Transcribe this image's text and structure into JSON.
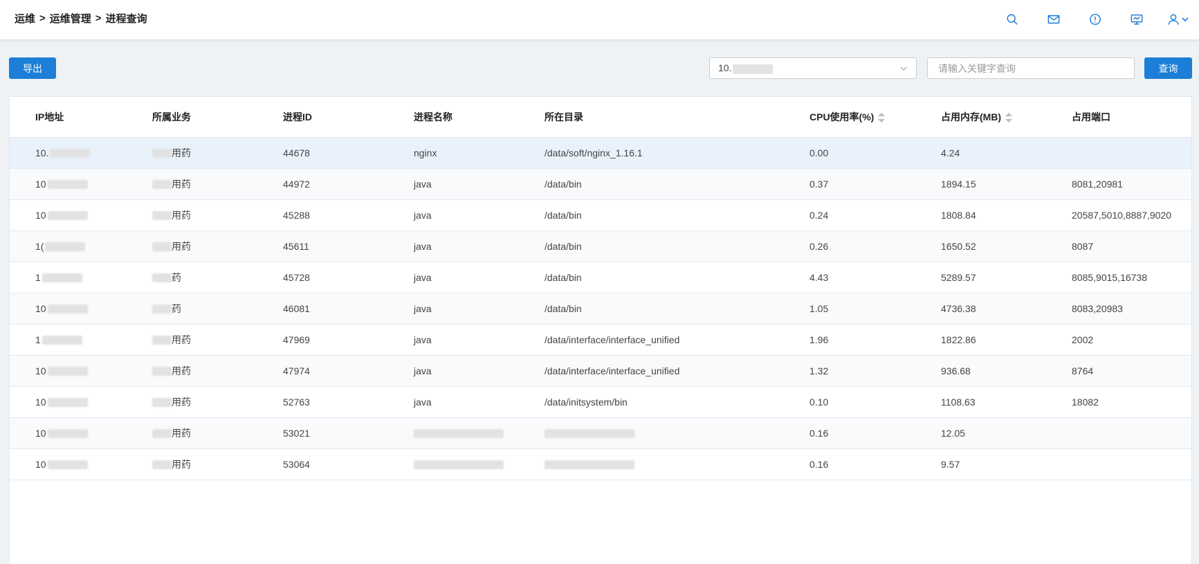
{
  "breadcrumb": {
    "items": [
      "运维",
      "运维管理",
      "进程查询"
    ],
    "separator": ">"
  },
  "header": {
    "icons": [
      "search-icon",
      "mail-icon",
      "alert-icon",
      "monitor-icon",
      "user-icon",
      "chevron-down-icon"
    ]
  },
  "toolbar": {
    "export_label": "导出",
    "ip_select_value": "10.",
    "keyword_placeholder": "请输入关键字查询",
    "search_label": "查询"
  },
  "table": {
    "columns": [
      "IP地址",
      "所属业务",
      "进程ID",
      "进程名称",
      "所在目录",
      "CPU使用率(%)",
      "占用内存(MB)",
      "占用端口"
    ],
    "rows": [
      {
        "ip": "10.",
        "business": "用药",
        "pid": "44678",
        "name": "nginx",
        "dir": "/data/soft/nginx_1.16.1",
        "cpu": "0.00",
        "mem": "4.24",
        "ports": ""
      },
      {
        "ip": "10",
        "business": "用药",
        "pid": "44972",
        "name": "java",
        "dir": "/data/bin",
        "cpu": "0.37",
        "mem": "1894.15",
        "ports": "8081,20981"
      },
      {
        "ip": "10",
        "business": "用药",
        "pid": "45288",
        "name": "java",
        "dir": "/data/bin",
        "cpu": "0.24",
        "mem": "1808.84",
        "ports": "20587,5010,8887,9020"
      },
      {
        "ip": "1(",
        "business": "用药",
        "pid": "45611",
        "name": "java",
        "dir": "/data/bin",
        "cpu": "0.26",
        "mem": "1650.52",
        "ports": "8087"
      },
      {
        "ip": "1",
        "business": "药",
        "pid": "45728",
        "name": "java",
        "dir": "/data/bin",
        "cpu": "4.43",
        "mem": "5289.57",
        "ports": "8085,9015,16738"
      },
      {
        "ip": "10",
        "business": "药",
        "pid": "46081",
        "name": "java",
        "dir": "/data/bin",
        "cpu": "1.05",
        "mem": "4736.38",
        "ports": "8083,20983"
      },
      {
        "ip": "1",
        "business": "用药",
        "pid": "47969",
        "name": "java",
        "dir": "/data/interface/interface_unified",
        "cpu": "1.96",
        "mem": "1822.86",
        "ports": "2002"
      },
      {
        "ip": "10",
        "business": "用药",
        "pid": "47974",
        "name": "java",
        "dir": "/data/interface/interface_unified",
        "cpu": "1.32",
        "mem": "936.68",
        "ports": "8764"
      },
      {
        "ip": "10",
        "business": "用药",
        "pid": "52763",
        "name": "java",
        "dir": "/data/initsystem/bin",
        "cpu": "0.10",
        "mem": "1108.63",
        "ports": "18082"
      },
      {
        "ip": "10",
        "business": "用药",
        "pid": "53021",
        "name": "",
        "dir": "",
        "cpu": "0.16",
        "mem": "12.05",
        "ports": ""
      },
      {
        "ip": "10",
        "business": "用药",
        "pid": "53064",
        "name": "",
        "dir": "",
        "cpu": "0.16",
        "mem": "9.57",
        "ports": ""
      }
    ]
  },
  "colors": {
    "primary": "#1c7ed6",
    "selected_row": "#e9f2fb"
  }
}
